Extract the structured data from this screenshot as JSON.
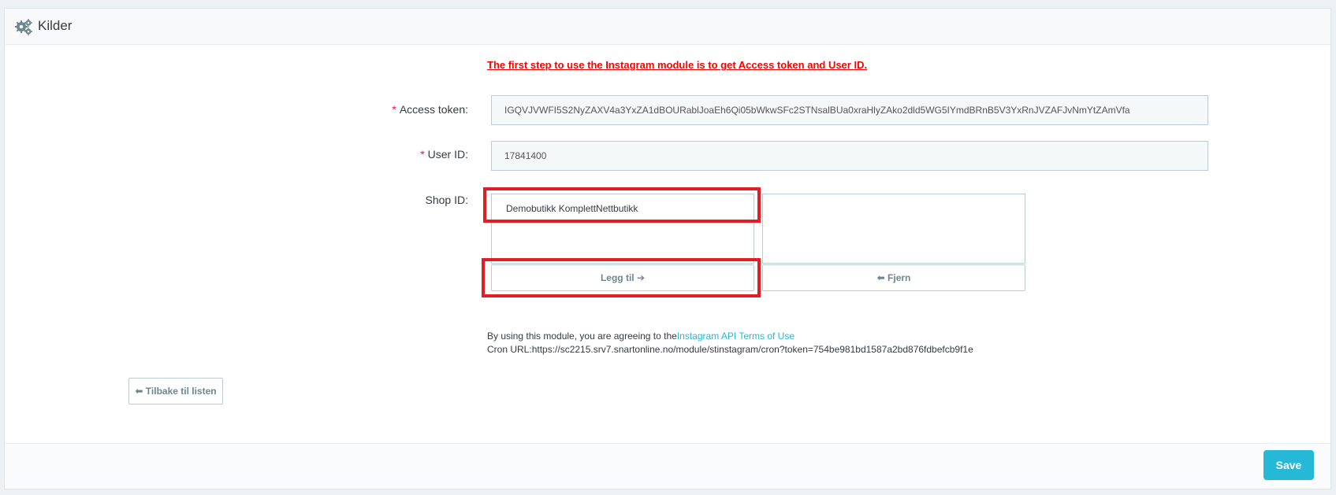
{
  "header": {
    "title": "Kilder",
    "icon": "gears-icon"
  },
  "form": {
    "warning": "The first step to use the Instagram module is to get Access token and User ID.",
    "access_token": {
      "required_marker": "*",
      "label": "Access token:",
      "value": "IGQVJVWFI5S2NyZAXV4a3YxZA1dBOURablJoaEh6Qi05bWkwSFc2STNsalBUa0xraHlyZAko2dld5WG5IYmdBRnB5V3YxRnJVZAFJvNmYtZAmVfa"
    },
    "user_id": {
      "required_marker": "*",
      "label": "User ID:",
      "value": "17841400"
    },
    "shop_id": {
      "label": "Shop ID:",
      "available": [
        "Demobutikk KomplettNettbutikk"
      ],
      "selected": [],
      "add_label": "Legg til",
      "remove_label": "Fjern"
    },
    "terms_prefix": "By using this module, you are agreeing to the",
    "terms_link": "Instagram API Terms of Use",
    "cron_prefix": "Cron URL:",
    "cron_url": "https://sc2215.srv7.snartonline.no/module/stinstagram/cron?token=754be981bd1587a2bd876fdbefcb9f1e",
    "back_label": "Tilbake til listen"
  },
  "footer": {
    "save_label": "Save"
  },
  "colors": {
    "accent": "#25b9d7",
    "warning": "#ff0000",
    "required": "#e50b70",
    "highlight": "#e21d23"
  }
}
